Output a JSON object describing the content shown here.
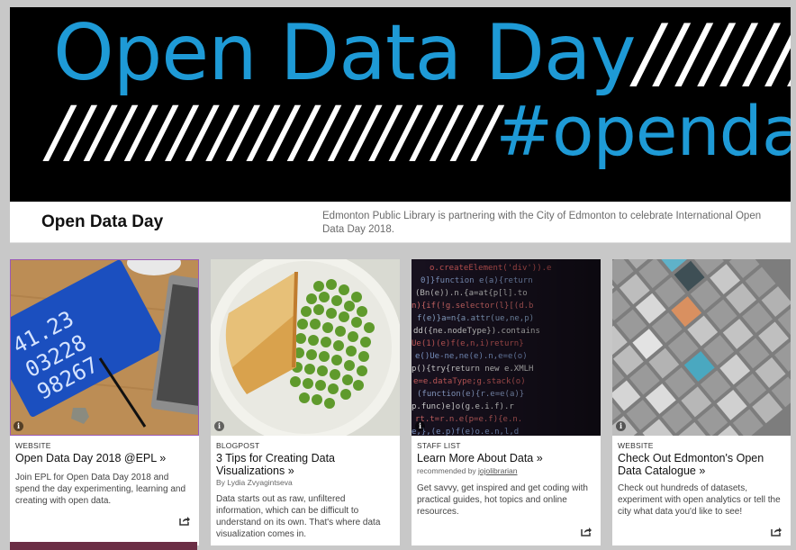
{
  "banner": {
    "line1_text": "Open Data Day",
    "line1_slashes": "////////",
    "line2_slashes": "//////////////////////",
    "line2_tag": "#opendataday"
  },
  "header": {
    "title": "Open Data Day",
    "description": "Edmonton Public Library is partnering with the City of Edmonton to celebrate International Open Data Day 2018."
  },
  "cards": [
    {
      "type": "WEBSITE",
      "title": "Open Data Day 2018 @EPL",
      "arrow": "»",
      "byline": "",
      "byline_user": "",
      "body": "Join EPL for Open Data Day 2018 and spend the day experimenting, learning and creating with open data."
    },
    {
      "type": "BLOGPOST",
      "title": "3 Tips for Creating Data Visualizations",
      "arrow": "»",
      "byline": "By Lydia Zvyagintseva",
      "byline_user": "",
      "body": "Data starts out as raw, unfiltered information, which can be difficult to understand on its own. That's where data visualization comes in."
    },
    {
      "type": "STAFF LIST",
      "title": "Learn More About Data",
      "arrow": "»",
      "byline": "recommended by ",
      "byline_user": "jojolibrarian",
      "body": "Get savvy, get inspired and get coding with practical guides, hot topics and online resources."
    },
    {
      "type": "WEBSITE",
      "title": "Check Out Edmonton's Open Data Catalogue",
      "arrow": "»",
      "byline": "",
      "byline_user": "",
      "body": "Check out hundreds of datasets, experiment with open analytics or tell the city what data you'd like to see!"
    }
  ],
  "icons": {
    "info": "info-icon",
    "share": "share-icon"
  },
  "colors": {
    "brand_blue": "#1e9ad6",
    "banner_bg": "#000000",
    "page_bg": "#c8c8c8"
  }
}
